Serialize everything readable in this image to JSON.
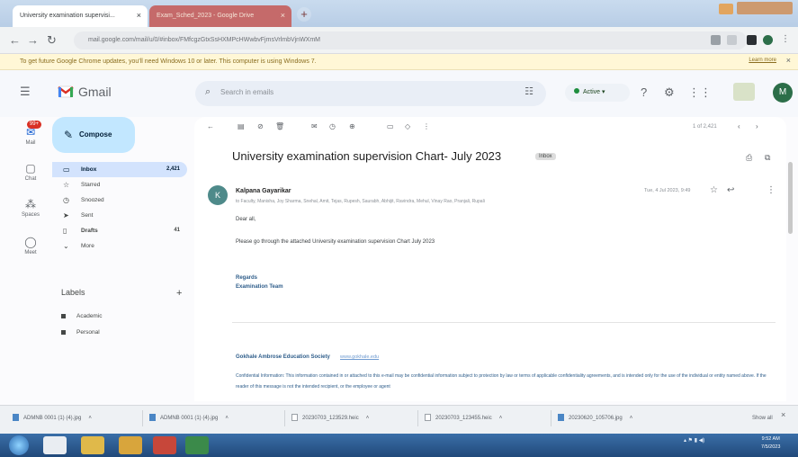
{
  "browser": {
    "tabs": [
      {
        "label": "University examination supervisi..."
      },
      {
        "label": "Exam_Sched_2023 - Google Drive"
      }
    ],
    "address": "mail.google.com/mail/u/0/#inbox/FMfcgzGtxSsHXMPcHWwbvFjmsVrlmbVjnWXmM",
    "infobar": {
      "message": "To get future Google Chrome updates, you'll need Windows 10 or later. This computer is using Windows 7.",
      "action": "Learn more"
    }
  },
  "gmail": {
    "logo_text": "Gmail",
    "search_placeholder": "Search in emails",
    "status": "Active",
    "avatar_letter": "M",
    "rail": [
      {
        "label": "Mail",
        "badge": "99+"
      },
      {
        "label": "Chat"
      },
      {
        "label": "Spaces"
      },
      {
        "label": "Meet"
      }
    ],
    "compose_label": "Compose",
    "nav": [
      {
        "label": "Inbox",
        "count": "2,421"
      },
      {
        "label": "Starred",
        "count": ""
      },
      {
        "label": "Snoozed",
        "count": ""
      },
      {
        "label": "Sent",
        "count": ""
      },
      {
        "label": "Drafts",
        "count": "41"
      },
      {
        "label": "More",
        "count": ""
      }
    ],
    "labels_title": "Labels",
    "labels": [
      "Academic",
      "Personal"
    ]
  },
  "email": {
    "pager": "1 of 2,421",
    "subject": "University examination supervision Chart- July 2023",
    "chip": "Inbox",
    "sender_initial": "K",
    "sender_name": "Kalpana Gayarikar",
    "recipients": "to Faculty, Manisha, Joy Sharma, Snehal, Amit, Tejas, Rupesh, Saurabh, Abhijit, Ravindra, Mehul, Vinay Rao, Pranjali, Rupali",
    "timestamp": "Tue, 4 Jul 2023, 9:49",
    "greeting": "Dear all,",
    "body": "Please go through the attached University examination supervision Chart July 2023",
    "regards": [
      "Regards",
      "Examination Team"
    ],
    "org_name": "Gokhale Ambrose Education Society",
    "org_link": "www.gokhale.edu",
    "disclaimer": "Confidential Information: This information contained in or attached to this e-mail may be confidential information subject to protection by law or terms of applicable confidentiality agreements, and is intended only for the use of the individual or entity named above. If the reader of this message is not the intended recipient, or the employee or agent"
  },
  "downloads": [
    "ADMNB 0001 (1) (4).jpg",
    "ADMNB 0001 (1) (4).jpg",
    "20230703_123529.heic",
    "20230703_123455.heic",
    "20230620_105706.jpg"
  ],
  "downloads_show_all": "Show all",
  "taskbar": {
    "time": "9:52 AM",
    "date": "7/5/2023"
  },
  "colors": {
    "compose": "#c2e7ff",
    "inbox_selected": "#d3e3fd",
    "accent": "#0b57d0",
    "taskbar": "#2b5c94"
  }
}
